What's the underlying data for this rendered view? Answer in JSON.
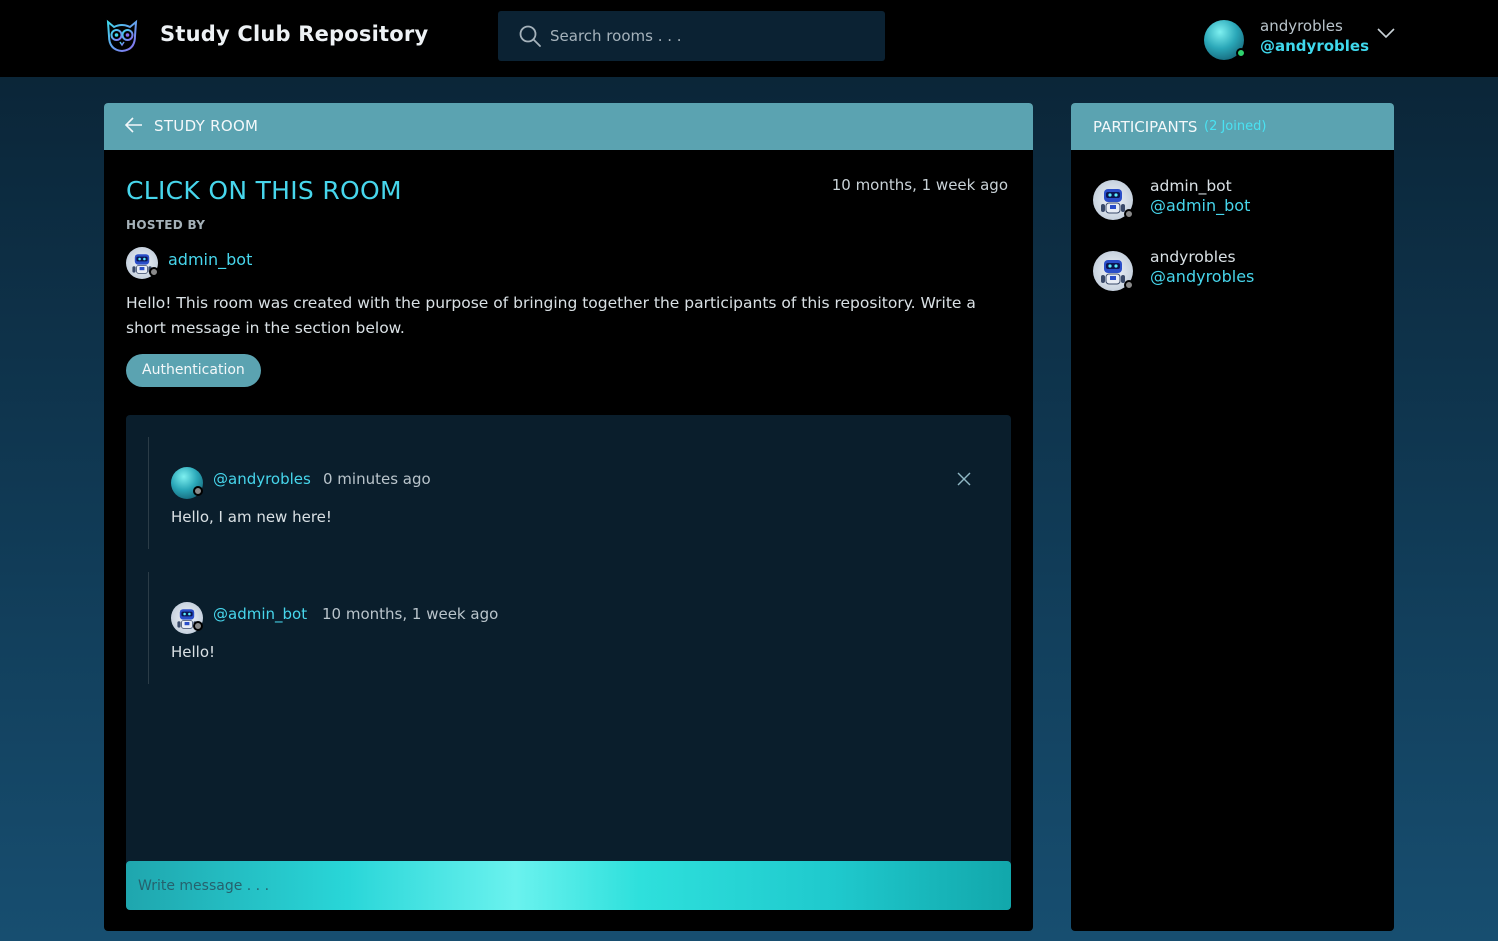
{
  "app": {
    "title": "Study Club Repository",
    "logo_icon": "owl-icon"
  },
  "search": {
    "placeholder": "Search rooms . . ."
  },
  "current_user": {
    "name": "andyrobles",
    "handle": "@andyrobles",
    "status": "online"
  },
  "room": {
    "header_label": "STUDY ROOM",
    "title": "CLICK ON THIS ROOM",
    "created": "10 months, 1 week ago",
    "hosted_by_label": "HOSTED BY",
    "host": {
      "name": "admin_bot"
    },
    "description": "Hello! This room was created with the purpose of bringing together the participants of this repository. Write a short message in the section below.",
    "topic": "Authentication"
  },
  "messages": [
    {
      "user": "@andyrobles",
      "time": "0 minutes ago",
      "body": "Hello, I am new here!",
      "deletable": true
    },
    {
      "user": "@admin_bot",
      "time": "10 months, 1 week ago",
      "body": "Hello!",
      "deletable": false
    }
  ],
  "composer": {
    "placeholder": "Write message . . ."
  },
  "participants": {
    "title": "PARTICIPANTS",
    "count_label": "(2 Joined)",
    "list": [
      {
        "name": "admin_bot",
        "handle": "@admin_bot"
      },
      {
        "name": "andyrobles",
        "handle": "@andyrobles"
      }
    ]
  },
  "colors": {
    "accent": "#47d6ec",
    "header_bar": "#5ba3b1",
    "online": "#2fd36e"
  }
}
